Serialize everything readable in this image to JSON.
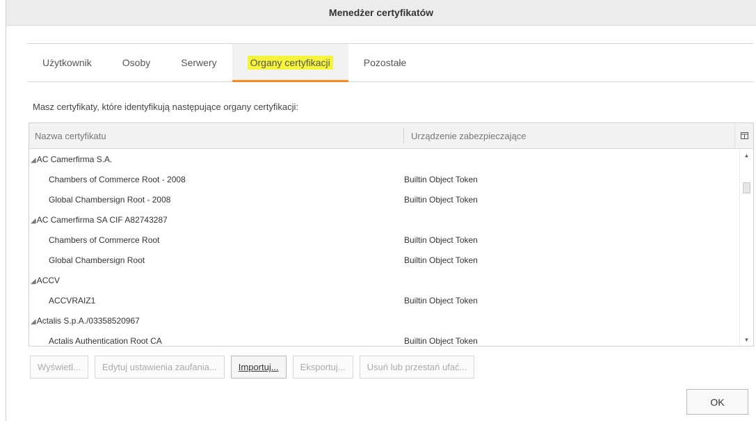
{
  "window": {
    "title": "Menedżer certyfikatów"
  },
  "tabs": [
    {
      "label": "Użytkownik",
      "active": false
    },
    {
      "label": "Osoby",
      "active": false
    },
    {
      "label": "Serwery",
      "active": false
    },
    {
      "label": "Organy certyfikacji",
      "active": true
    },
    {
      "label": "Pozostałe",
      "active": false
    }
  ],
  "description": "Masz certyfikaty, które identyfikują następujące organy certyfikacji:",
  "table": {
    "columns": {
      "name": "Nazwa certyfikatu",
      "device": "Urządzenie zabezpieczające"
    },
    "rows": [
      {
        "type": "group",
        "name": "AC Camerfirma S.A.",
        "device": ""
      },
      {
        "type": "item",
        "name": "Chambers of Commerce Root - 2008",
        "device": "Builtin Object Token"
      },
      {
        "type": "item",
        "name": "Global Chambersign Root - 2008",
        "device": "Builtin Object Token"
      },
      {
        "type": "group",
        "name": "AC Camerfirma SA CIF A82743287",
        "device": ""
      },
      {
        "type": "item",
        "name": "Chambers of Commerce Root",
        "device": "Builtin Object Token"
      },
      {
        "type": "item",
        "name": "Global Chambersign Root",
        "device": "Builtin Object Token"
      },
      {
        "type": "group",
        "name": "ACCV",
        "device": ""
      },
      {
        "type": "item",
        "name": "ACCVRAIZ1",
        "device": "Builtin Object Token"
      },
      {
        "type": "group",
        "name": "Actalis S.p.A./03358520967",
        "device": ""
      },
      {
        "type": "item",
        "name": "Actalis Authentication Root CA",
        "device": "Builtin Object Token"
      }
    ]
  },
  "buttons": [
    {
      "label": "Wyświetl...",
      "enabled": false,
      "name": "view-button"
    },
    {
      "label": "Edytuj ustawienia zaufania...",
      "enabled": false,
      "name": "edit-trust-button"
    },
    {
      "label": "Importuj...",
      "enabled": true,
      "name": "import-button"
    },
    {
      "label": "Eksportuj...",
      "enabled": false,
      "name": "export-button"
    },
    {
      "label": "Usuń lub przestań ufać...",
      "enabled": false,
      "name": "delete-distrust-button"
    }
  ],
  "ok_label": "OK",
  "icons": {
    "twisty": "expanded-triangle-icon",
    "column_picker": "column-picker-icon"
  },
  "colors": {
    "tab_highlight": "#f5f33a",
    "tab_underline": "#ff8a1c"
  }
}
